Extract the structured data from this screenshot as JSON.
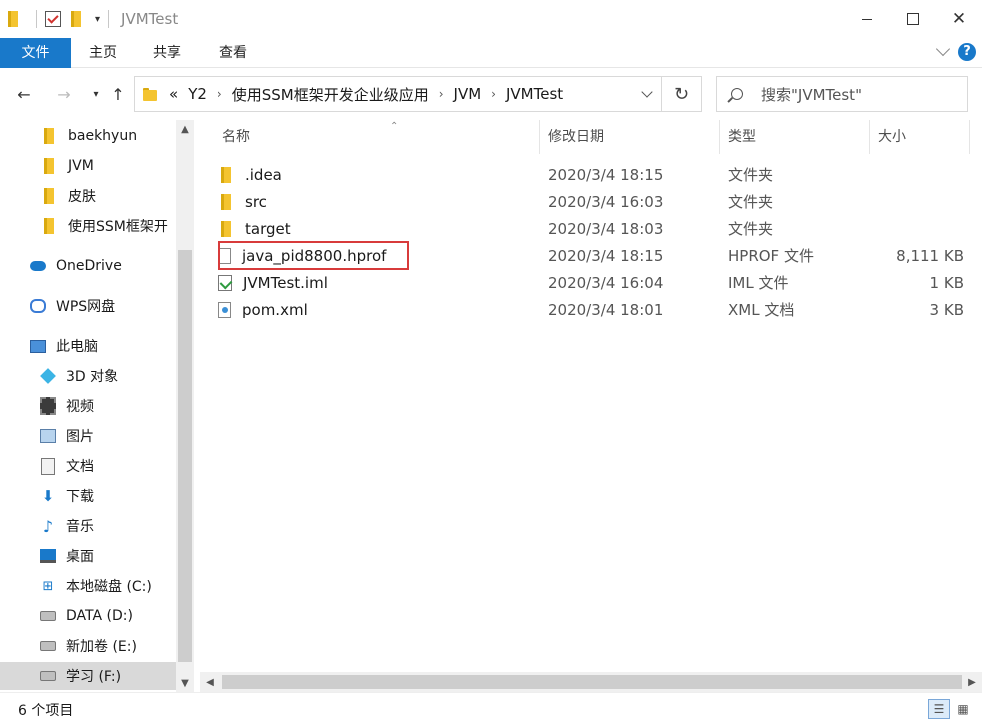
{
  "window": {
    "title": "JVMTest"
  },
  "ribbon": {
    "tabs": [
      "文件",
      "主页",
      "共享",
      "查看"
    ],
    "help": "?"
  },
  "address": {
    "crumbs": [
      "«",
      "Y2",
      "使用SSM框架开发企业级应用",
      "JVM",
      "JVMTest"
    ]
  },
  "search": {
    "placeholder": "搜索\"JVMTest\""
  },
  "sidebar": {
    "items": [
      {
        "label": "baekhyun",
        "icon": "folder-icon"
      },
      {
        "label": "JVM",
        "icon": "folder-icon"
      },
      {
        "label": "皮肤",
        "icon": "folder-icon"
      },
      {
        "label": "使用SSM框架开",
        "icon": "folder-icon"
      },
      {
        "label": "OneDrive",
        "icon": "onedrive-icon"
      },
      {
        "label": "WPS网盘",
        "icon": "wps-cloud-icon"
      },
      {
        "label": "此电脑",
        "icon": "computer-icon"
      },
      {
        "label": "3D 对象",
        "icon": "3d-objects-icon"
      },
      {
        "label": "视频",
        "icon": "video-icon"
      },
      {
        "label": "图片",
        "icon": "pictures-icon"
      },
      {
        "label": "文档",
        "icon": "documents-icon"
      },
      {
        "label": "下载",
        "icon": "download-icon"
      },
      {
        "label": "音乐",
        "icon": "music-icon"
      },
      {
        "label": "桌面",
        "icon": "desktop-icon"
      },
      {
        "label": "本地磁盘 (C:)",
        "icon": "windows-drive-icon"
      },
      {
        "label": "DATA (D:)",
        "icon": "drive-icon"
      },
      {
        "label": "新加卷 (E:)",
        "icon": "drive-icon"
      },
      {
        "label": "学习 (F:)",
        "icon": "drive-icon"
      }
    ]
  },
  "columns": {
    "name": "名称",
    "date": "修改日期",
    "type": "类型",
    "size": "大小"
  },
  "files": [
    {
      "name": ".idea",
      "date": "2020/3/4 18:15",
      "type": "文件夹",
      "size": "",
      "icon": "folder-icon"
    },
    {
      "name": "src",
      "date": "2020/3/4 16:03",
      "type": "文件夹",
      "size": "",
      "icon": "folder-icon"
    },
    {
      "name": "target",
      "date": "2020/3/4 18:03",
      "type": "文件夹",
      "size": "",
      "icon": "folder-icon"
    },
    {
      "name": "java_pid8800.hprof",
      "date": "2020/3/4 18:15",
      "type": "HPROF 文件",
      "size": "8,111 KB",
      "icon": "file-icon"
    },
    {
      "name": "JVMTest.iml",
      "date": "2020/3/4 16:04",
      "type": "IML 文件",
      "size": "1 KB",
      "icon": "iml-file-icon"
    },
    {
      "name": "pom.xml",
      "date": "2020/3/4 18:01",
      "type": "XML 文档",
      "size": "3 KB",
      "icon": "xml-file-icon"
    }
  ],
  "status": {
    "count": "6 个项目"
  }
}
